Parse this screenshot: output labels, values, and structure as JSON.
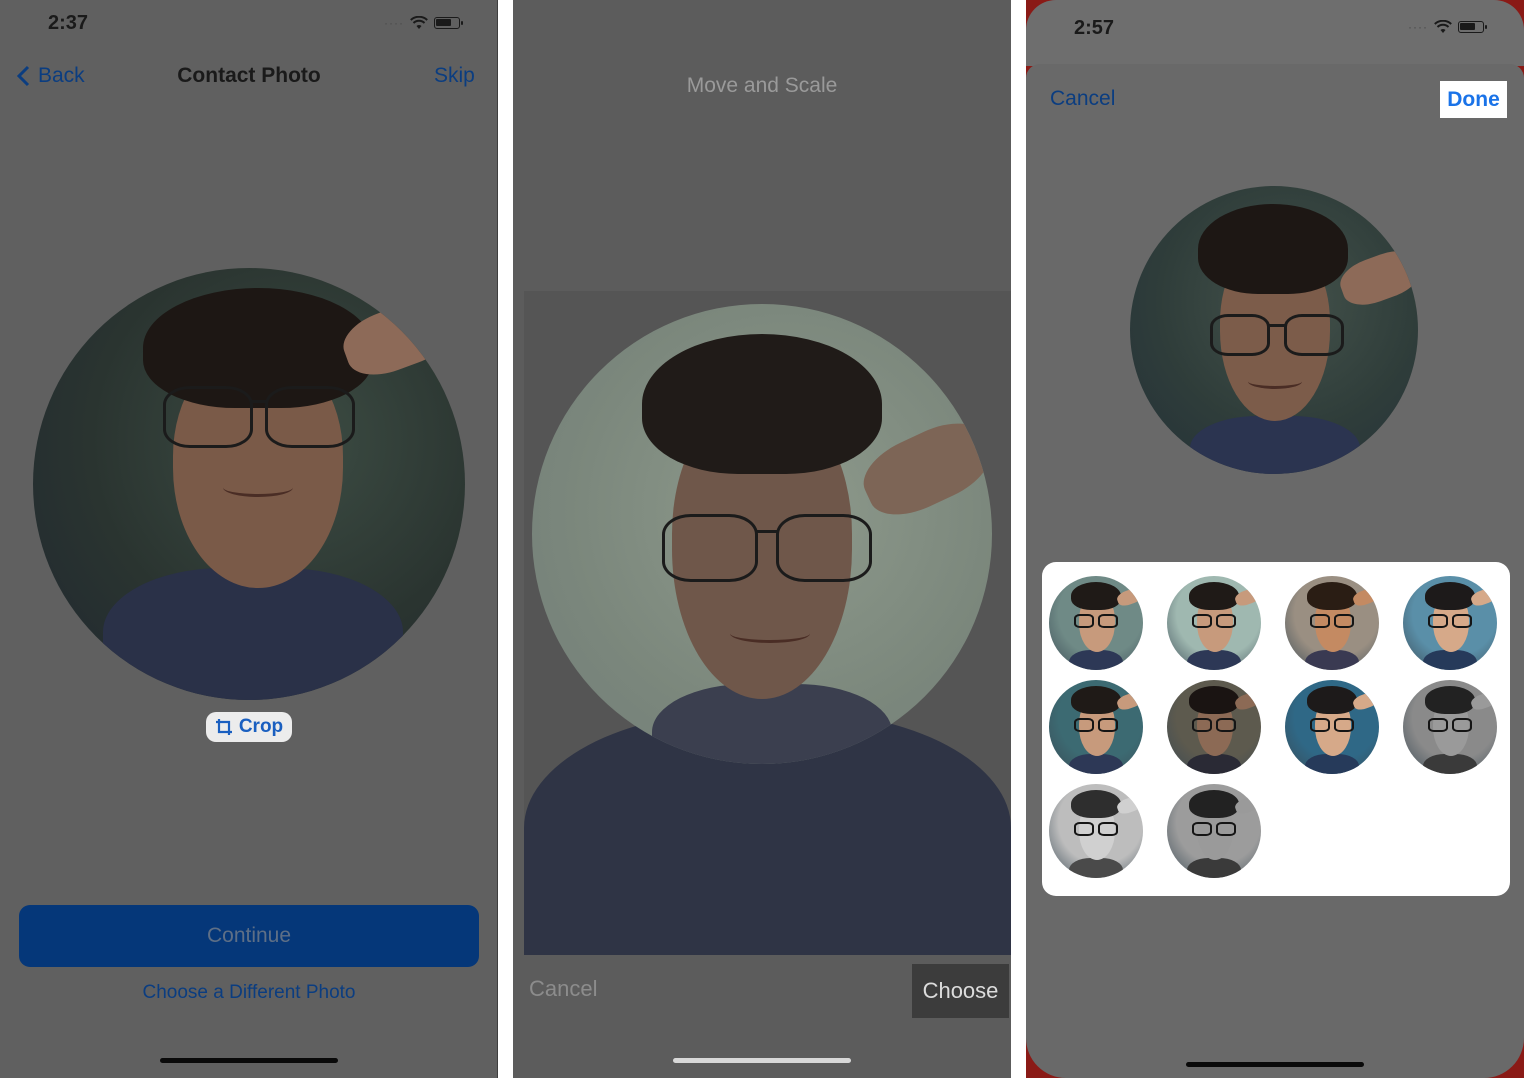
{
  "panel1": {
    "status_time": "2:37",
    "back_label": "Back",
    "title": "Contact Photo",
    "skip_label": "Skip",
    "crop_label": "Crop",
    "continue_label": "Continue",
    "choose_different_label": "Choose a Different Photo"
  },
  "panel2": {
    "title": "Move and Scale",
    "cancel_label": "Cancel",
    "choose_label": "Choose"
  },
  "panel3": {
    "status_time": "2:57",
    "cancel_label": "Cancel",
    "done_label": "Done",
    "filters": [
      {
        "name": "filter-1",
        "bg": "#6f8a86",
        "tone": "color"
      },
      {
        "name": "filter-2",
        "bg": "#9fb8b0",
        "tone": "color"
      },
      {
        "name": "filter-3",
        "bg": "#9a8f82",
        "tone": "warm"
      },
      {
        "name": "filter-4",
        "bg": "#5a8fa8",
        "tone": "cool"
      },
      {
        "name": "filter-5",
        "bg": "#3c6a72",
        "tone": "color"
      },
      {
        "name": "filter-6",
        "bg": "#5d5a4e",
        "tone": "dark"
      },
      {
        "name": "filter-7",
        "bg": "#2f6886",
        "tone": "cool"
      },
      {
        "name": "filter-8",
        "bg": "#8a8a8a",
        "tone": "mono"
      },
      {
        "name": "filter-9",
        "bg": "#bdbdbd",
        "tone": "mono-light"
      },
      {
        "name": "filter-10",
        "bg": "#9c9c9c",
        "tone": "mono"
      }
    ]
  },
  "colors": {
    "ios_blue": "#1a73e8",
    "dim_overlay": "#606060"
  }
}
